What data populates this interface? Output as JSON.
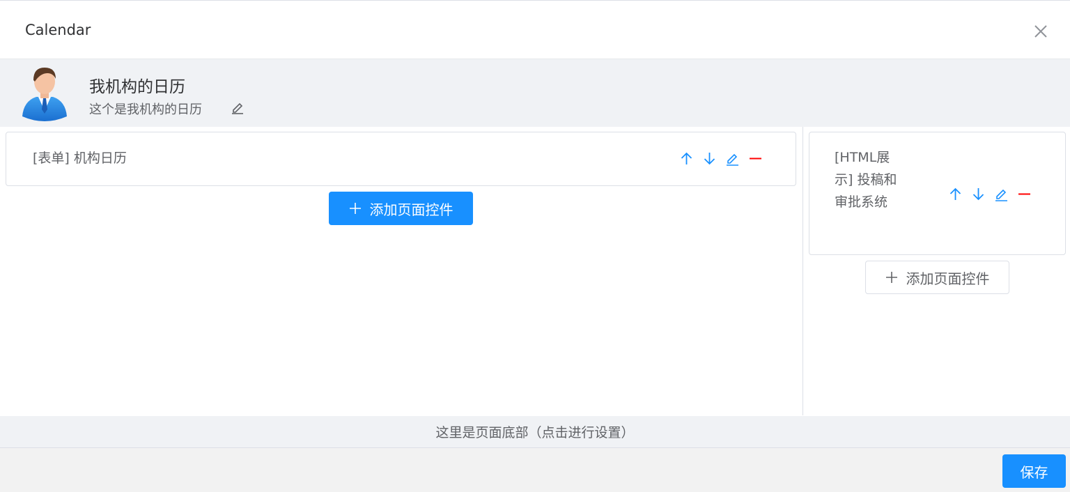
{
  "dialog": {
    "title": "Calendar",
    "close_icon": "close-icon"
  },
  "profile": {
    "avatar_icon": "user-avatar-icon",
    "name": "我机构的日历",
    "description": "这个是我机构的日历",
    "edit_icon": "edit-icon"
  },
  "left_column": {
    "widgets": [
      {
        "label": "[表单] 机构日历"
      }
    ],
    "add_button_label": "添加页面控件"
  },
  "right_column": {
    "widgets": [
      {
        "label": "[HTML展示] 投稿和审批系统"
      }
    ],
    "add_button_label": "添加页面控件"
  },
  "widget_actions": {
    "icons": [
      "arrow-up-icon",
      "arrow-down-icon",
      "edit-icon",
      "remove-icon"
    ],
    "accent_color": "#1890ff",
    "danger_color": "#ff0000"
  },
  "footer_bar": {
    "label": "这里是页面底部（点击进行设置）"
  },
  "dialog_footer": {
    "save_label": "保存"
  },
  "colors": {
    "primary": "#1890ff",
    "panel_bg": "#f0f2f5"
  }
}
